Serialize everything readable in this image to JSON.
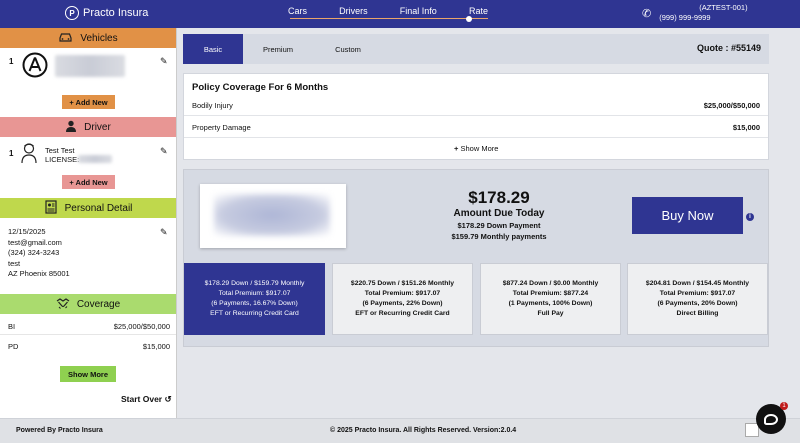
{
  "header": {
    "brand": "Practo Insura",
    "steps": [
      "Cars",
      "Drivers",
      "Final Info",
      "Rate"
    ],
    "agent_id": "(AZTEST-001)",
    "phone": "(999) 999-9999"
  },
  "sidebar": {
    "vehicles": {
      "title": "Vehicles",
      "item_number": "1",
      "add_label": "+ Add New",
      "icon": "car-icon"
    },
    "driver": {
      "title": "Driver",
      "item_number": "1",
      "name": "Test Test",
      "license_label": "LICENSE:",
      "add_label": "+ Add New",
      "icon": "person-icon"
    },
    "personal": {
      "title": "Personal Detail",
      "dob": "12/15/2025",
      "email": "test@gmail.com",
      "phone": "(324) 324-3243",
      "name": "test",
      "address": "AZ Phoenix 85001",
      "icon": "document-icon"
    },
    "coverage": {
      "title": "Coverage",
      "icon": "handshake-icon",
      "items": [
        {
          "label": "BI",
          "value": "$25,000/$50,000"
        },
        {
          "label": "PD",
          "value": "$15,000"
        }
      ],
      "show_more_label": "Show More"
    },
    "start_over_label": "Start Over"
  },
  "main": {
    "tabs": [
      "Basic",
      "Premium",
      "Custom"
    ],
    "quote": "Quote : #55149",
    "policy": {
      "title": "Policy Coverage For 6 Months",
      "rows": [
        {
          "label": "Bodily Injury",
          "value": "$25,000/$50,000"
        },
        {
          "label": "Property Damage",
          "value": "$15,000"
        }
      ],
      "show_more_label": "Show More"
    },
    "payment": {
      "amount": "$178.29",
      "amount_label": "Amount Due Today",
      "down_text": "$178.29 Down Payment",
      "monthly_text": "$159.79 Monthly payments",
      "buy_label": "Buy Now",
      "plans": [
        {
          "line1": "$178.29 Down / $159.79 Monthly",
          "line2": "Total Premium: $917.07",
          "line3": "(6 Payments, 16.67% Down)",
          "line4": "EFT or Recurring Credit Card"
        },
        {
          "line1": "$220.75 Down / $151.26 Monthly",
          "line2": "Total Premium: $917.07",
          "line3": "(6 Payments, 22% Down)",
          "line4": "EFT or Recurring Credit Card"
        },
        {
          "line1": "$877.24 Down / $0.00 Monthly",
          "line2": "Total Premium: $877.24",
          "line3": "(1 Payments, 100% Down)",
          "line4": "Full Pay"
        },
        {
          "line1": "$204.81 Down / $154.45 Monthly",
          "line2": "Total Premium: $917.07",
          "line3": "(6 Payments, 20% Down)",
          "line4": "Direct Billing"
        }
      ]
    }
  },
  "footer": {
    "left": "Powered By Practo Insura",
    "center": "© 2025 Practo Insura. All Rights Reserved. Version:2.0.4"
  },
  "colors": {
    "primary": "#2f3592",
    "vehicle": "#e19146",
    "driver": "#e89694",
    "personal": "#bfd84c",
    "coverage": "#aadb6e"
  }
}
